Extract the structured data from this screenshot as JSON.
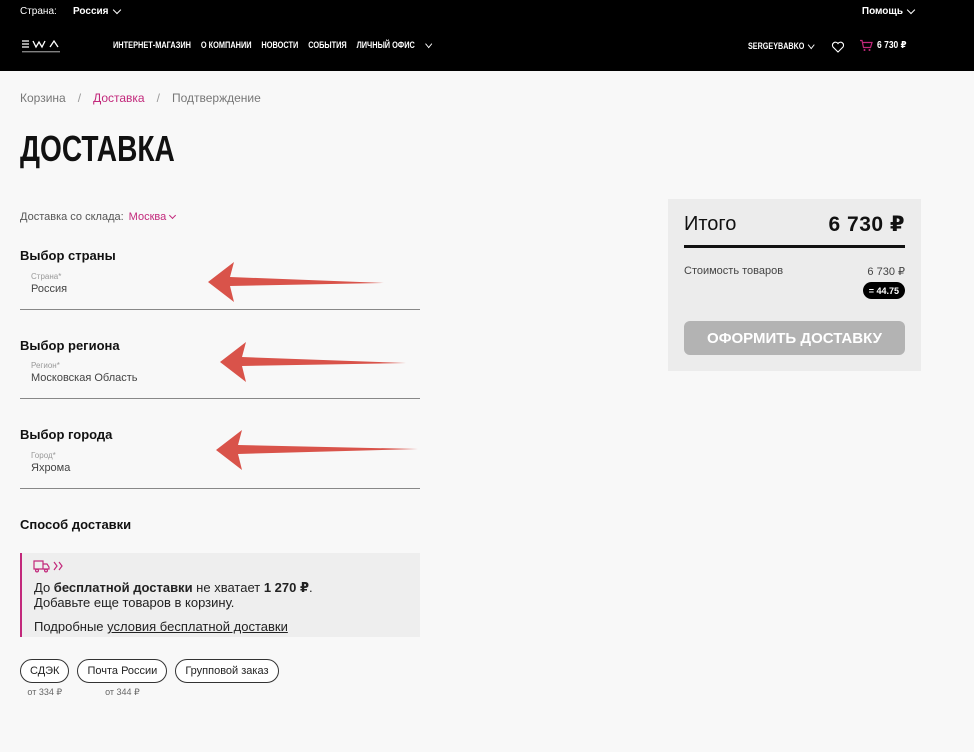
{
  "header": {
    "country_label": "Страна:",
    "country_value": "Россия",
    "help_label": "Помощь",
    "nav": [
      "ИНТЕРНЕТ-МАГАЗИН",
      "О КОМПАНИИ",
      "НОВОСТИ",
      "СОБЫТИЯ",
      "ЛИЧНЫЙ ОФИС"
    ],
    "user": "SERGEYBABKO",
    "cart_total": "6 730 ₽"
  },
  "breadcrumbs": [
    "Корзина",
    "Доставка",
    "Подтверждение"
  ],
  "page_title": "ДОСТАВКА",
  "warehouse": {
    "label": "Доставка со склада:",
    "city": "Москва"
  },
  "sections": {
    "country": {
      "heading": "Выбор страны",
      "field_label": "Страна*",
      "value": "Россия"
    },
    "region": {
      "heading": "Выбор региона",
      "field_label": "Регион*",
      "value": "Московская Область"
    },
    "city": {
      "heading": "Выбор города",
      "field_label": "Город*",
      "value": "Яхрома"
    },
    "method": {
      "heading": "Способ доставки"
    }
  },
  "notice": {
    "p1": "До ",
    "b1": "бесплатной доставки",
    "p2": " не хватает ",
    "b2": "1 270 ₽",
    "p3": ".",
    "line2": "Добавьте еще товаров в корзину.",
    "line3_pre": "Подробные ",
    "line3_link": "условия бесплатной доставки"
  },
  "delivery_options": [
    {
      "label": "СДЭК",
      "price": "от 334 ₽"
    },
    {
      "label": "Почта России",
      "price": "от 344 ₽"
    },
    {
      "label": "Групповой заказ",
      "price": ""
    }
  ],
  "summary": {
    "total_label": "Итого",
    "total_value": "6 730 ₽",
    "goods_label": "Стоимость товаров",
    "goods_value": "6 730 ₽",
    "points_badge": "= 44.75",
    "cta_label": "ОФОРМИТЬ ДОСТАВКУ"
  },
  "colors": {
    "accent": "#c2287b",
    "arrow": "#d9534a",
    "header_bg": "#000000",
    "cta_disabled": "#b3b3b3"
  }
}
